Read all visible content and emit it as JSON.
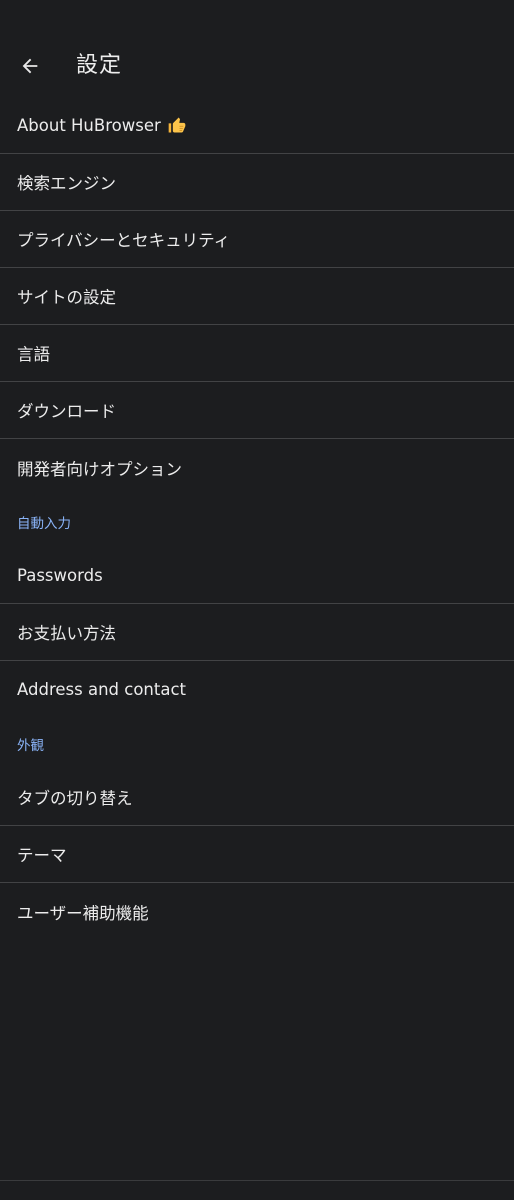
{
  "header": {
    "title": "設定",
    "back_icon": "arrow-back-icon"
  },
  "items_group1": [
    {
      "label": "About HuBrowser",
      "icon": "thumbs-up-icon"
    },
    {
      "label": "検索エンジン"
    },
    {
      "label": "プライバシーとセキュリティ"
    },
    {
      "label": "サイトの設定"
    },
    {
      "label": "言語"
    },
    {
      "label": "ダウンロード"
    },
    {
      "label": "開発者向けオプション"
    }
  ],
  "section_autofill": {
    "header": "自動入力",
    "items": [
      {
        "label": "Passwords"
      },
      {
        "label": "お支払い方法"
      },
      {
        "label": "Address and contact"
      }
    ]
  },
  "section_appearance": {
    "header": "外観",
    "items": [
      {
        "label": "タブの切り替え"
      },
      {
        "label": "テーマ"
      },
      {
        "label": "ユーザー補助機能"
      }
    ]
  },
  "colors": {
    "background": "#1c1d1f",
    "text": "#ececec",
    "section_header": "#8ab4f8",
    "divider": "#424345"
  }
}
